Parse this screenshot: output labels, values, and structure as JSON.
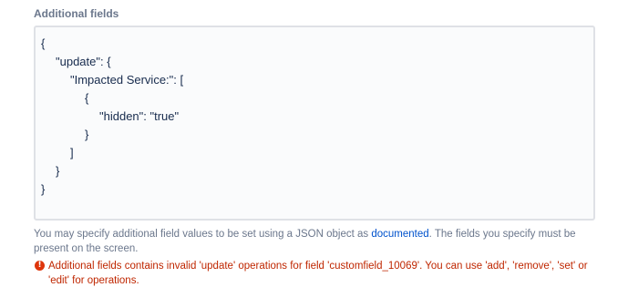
{
  "field": {
    "label": "Additional fields"
  },
  "json_editor": {
    "lines": [
      {
        "text": "{",
        "indent": 0
      },
      {
        "text": "\"update\": {",
        "indent": 1
      },
      {
        "text": "\"Impacted Service:\": [",
        "indent": 2
      },
      {
        "text": "{",
        "indent": 3
      },
      {
        "text": "\"hidden\": \"true\"",
        "indent": 4
      },
      {
        "text": "}",
        "indent": 3
      },
      {
        "text": "]",
        "indent": 2
      },
      {
        "text": "}",
        "indent": 1
      },
      {
        "text": "}",
        "indent": 0
      }
    ]
  },
  "help": {
    "prefix": "You may specify additional field values to be set using a JSON object as ",
    "link_text": "documented",
    "suffix": ". The fields you specify must be present on the screen."
  },
  "error": {
    "icon": "error-icon",
    "message": "Additional fields contains invalid 'update' operations for field 'customfield_10069'. You can use 'add', 'remove', 'set' or 'edit' for operations.",
    "color": "#de350b"
  },
  "colors": {
    "label": "#6b778c",
    "link": "#0052cc",
    "error_text": "#bf2600",
    "editor_border": "#dfe1e6",
    "editor_bg": "#fafbfc"
  }
}
